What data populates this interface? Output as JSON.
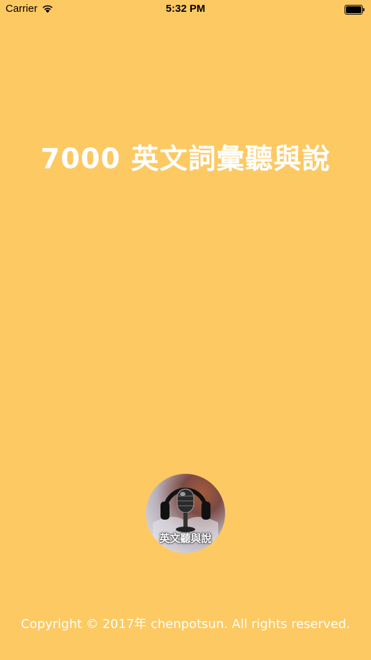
{
  "status_bar": {
    "carrier": "Carrier",
    "time": "5:32 PM",
    "wifi_icon": "wifi-icon",
    "battery_icon": "battery-icon"
  },
  "splash": {
    "title": "7000 英文詞彙聽與說",
    "logo_label": "英文聽與說",
    "logo_icon": "microphone-headphones-icon",
    "copyright": "Copyright © 2017年 chenpotsun. All rights reserved.",
    "background_color": "#FDC963"
  }
}
